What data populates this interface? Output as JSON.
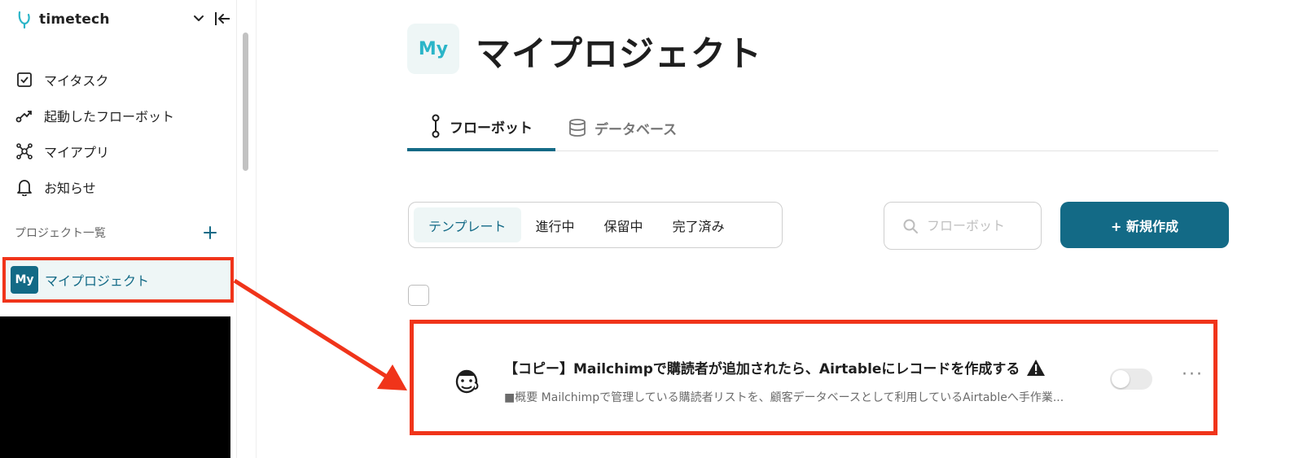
{
  "sidebar": {
    "brand_name": "timetech",
    "nav": [
      {
        "label": "マイタスク",
        "icon": "checkbox-icon"
      },
      {
        "label": "起動したフローボット",
        "icon": "flow-icon"
      },
      {
        "label": "マイアプリ",
        "icon": "network-icon"
      },
      {
        "label": "お知らせ",
        "icon": "bell-icon"
      }
    ],
    "projects_heading": "プロジェクト一覧",
    "project": {
      "badge": "My",
      "label": "マイプロジェクト"
    }
  },
  "main": {
    "page_icon": "My",
    "title": "マイプロジェクト",
    "tabs": [
      {
        "label": "フローボット",
        "active": true
      },
      {
        "label": "データベース",
        "active": false
      }
    ],
    "filters": [
      {
        "label": "テンプレート",
        "active": true
      },
      {
        "label": "進行中",
        "active": false
      },
      {
        "label": "保留中",
        "active": false
      },
      {
        "label": "完了済み",
        "active": false
      }
    ],
    "search": {
      "placeholder": "フローボット"
    },
    "new_button": "+ 新規作成",
    "flow": {
      "title": "【コピー】Mailchimpで購読者が追加されたら、Airtableにレコードを作成する",
      "description": "■概要 Mailchimpで管理している購読者リストを、顧客データベースとして利用しているAirtableへ手作業...",
      "enabled": false,
      "more": "···"
    }
  },
  "colors": {
    "accent": "#136a86",
    "highlight": "#f0341a",
    "tint": "#eef6f6"
  }
}
